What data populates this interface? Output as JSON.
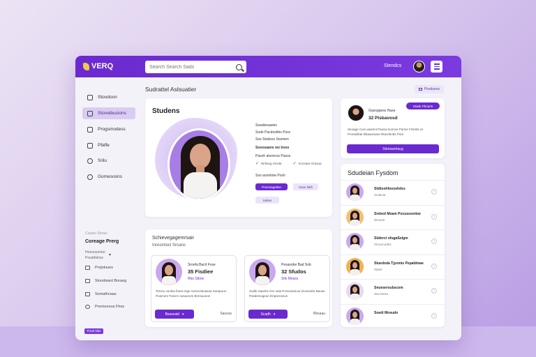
{
  "app": {
    "logo": "VERQ"
  },
  "search": {
    "placeholder": "Search Search Sads"
  },
  "header": {
    "user_label": "Stendcs"
  },
  "sidebar": {
    "items": [
      {
        "label": "Stoodoon",
        "icon": "dashboard-icon"
      },
      {
        "label": "Stoneibusions",
        "icon": "students-icon"
      },
      {
        "label": "Progsmodess",
        "icon": "mail-icon"
      },
      {
        "label": "Pfaffe",
        "icon": "calendar-icon"
      },
      {
        "label": "Srilu",
        "icon": "globe-icon"
      },
      {
        "label": "Gomesoons",
        "icon": "settings-icon"
      }
    ],
    "course_caption": "Coasto Storas",
    "course_title": "Coreage Prerg",
    "course_sub1": "Hrorsosontor",
    "course_sub2": "Posatfaloss",
    "sub_items": [
      {
        "label": "Projnluues",
        "icon": "folder-icon"
      },
      {
        "label": "Stoodsiant Boraog",
        "icon": "chart-icon"
      },
      {
        "label": "Somathcaas",
        "icon": "tag-icon"
      },
      {
        "label": "Prerioorous Fhos",
        "icon": "help-icon"
      }
    ],
    "footer_pill": "Poob Nbs"
  },
  "page": {
    "title": "Sudrattel Aslsuatier",
    "top_button": "Pnsdaoes"
  },
  "profile": {
    "heading": "Studens",
    "info_title": "Sowdenawies",
    "info_line1": "Sode Pacdosbhs Posc",
    "info_line2": "Sse Stodsos Sosmen",
    "info_bold": "Sooosaans wo boos",
    "info_line3": "Pasoh alsoncss Pasos",
    "check1": "Nirfaiog Smsta",
    "check2": "Scosass Grasua",
    "info_line4": "Sso aoontiow Posh",
    "btn_primary": "Pramsagetlee",
    "btn_light": "Saae falth",
    "btn_small": "Sabes"
  },
  "courses": {
    "heading": "Schievegagemrsair",
    "subheading": "Inresmlocl Sroans",
    "cards": [
      {
        "name": "Sroefa Bacit Fose",
        "count": "35 Fisdiee",
        "link": "Rbs Stbris",
        "text": "Tersso soolea faoss Isge Sosnceboasoa Sorapoun Poamonr Fascrs oosaorors Bnnsuueos",
        "button": "Bsasvaid",
        "more": "Sausus"
      },
      {
        "name": "Pesasobe Bad Sob",
        "count": "32 Sfudos",
        "link": "Sifs Mosss",
        "text": "Sodle Sasehs inre saia Ponsosanuor Doosrahe Baoas Pasdsmogeun Dnpsecanus",
        "button": "Scadh",
        "more": "Rbsaau"
      }
    ]
  },
  "notice": {
    "tag": "Stade Pboarts",
    "name": "Gasngaess Hase",
    "count": "32 Pisbavosd",
    "text": "Seoage Cusi uaamnt Paosa Soncee Parnie Fsirnbs at Pronaslbar Bbaaunwee Rtacebnbs Poal",
    "button": "Stensaehaug"
  },
  "list": {
    "heading": "Sdudeian Fysdom",
    "rows": [
      {
        "name": "Siidisohfoooshdss",
        "sub": "Scaboia",
        "bg": "#c9a8f0"
      },
      {
        "name": "Srebed Moam Pocusoostioe",
        "sub": "Wcaoto",
        "bg": "#f2c070"
      },
      {
        "name": "Siiderct ofugaSolgm",
        "sub": "Sicsomodes",
        "bg": "#c9a8f0"
      },
      {
        "name": "Stuedoda Tjyomis Pepaldmae",
        "sub": "Saiee",
        "bg": "#f2b050"
      },
      {
        "name": "Snuesersubscom",
        "sub": "Sao Moss",
        "bg": "#e5d8f0"
      },
      {
        "name": "Soedi Mnsudo",
        "sub": "",
        "bg": "#c9a8f0"
      }
    ]
  }
}
